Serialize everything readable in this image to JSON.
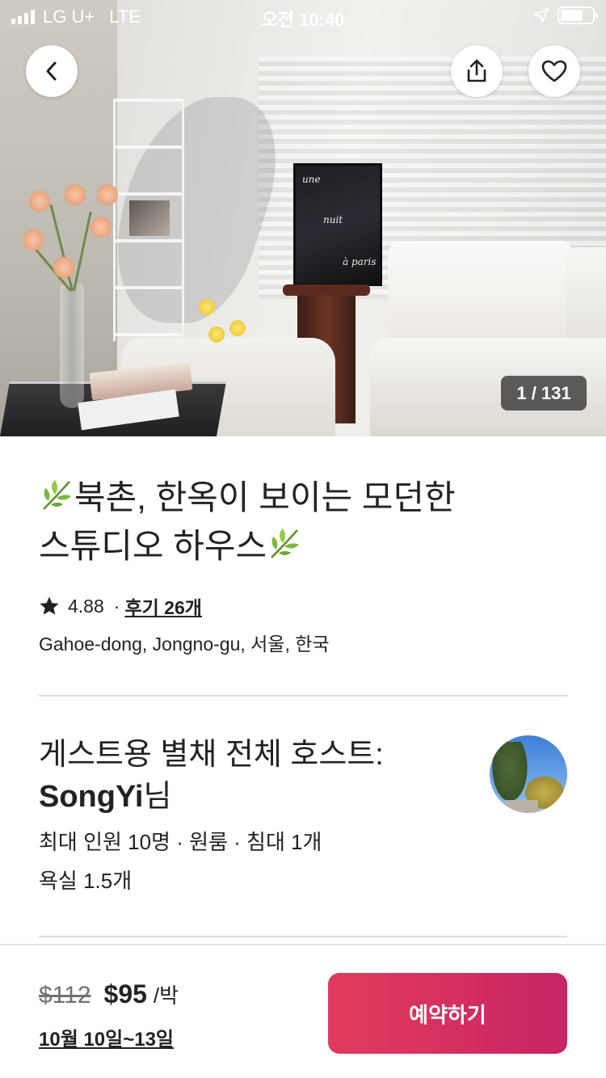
{
  "status_bar": {
    "carrier": "LG U+",
    "network": "LTE",
    "time": "오전 10:40"
  },
  "photo": {
    "counter": "1 / 131",
    "poster_text": [
      "une",
      "nuit",
      "à paris"
    ]
  },
  "actions": {
    "back_icon": "chevron-left-icon",
    "share_icon": "share-icon",
    "favorite_icon": "heart-icon"
  },
  "listing": {
    "title_line1": "북촌, 한옥이 보이는 모던한",
    "title_line2": "스튜디오 하우스",
    "title_emoji": "🌿",
    "rating": "4.88",
    "separator": "·",
    "reviews": "후기 26개",
    "location": "Gahoe-dong, Jongno-gu, 서울, 한국"
  },
  "host": {
    "title_prefix": "게스트용 별채 전체 호스트:",
    "name": "SongYi",
    "name_suffix": "님",
    "specs_line1": "최대 인원 10명 · 원룸 · 침대 1개",
    "specs_line2": "욕실 1.5개"
  },
  "booking": {
    "original_price": "$112",
    "price": "$95",
    "per": "/박",
    "dates": "10월 10일~13일",
    "reserve_label": "예약하기"
  },
  "colors": {
    "brand": "#D6305F",
    "text": "#222222",
    "muted": "#717171",
    "divider": "#DDDDDD"
  }
}
